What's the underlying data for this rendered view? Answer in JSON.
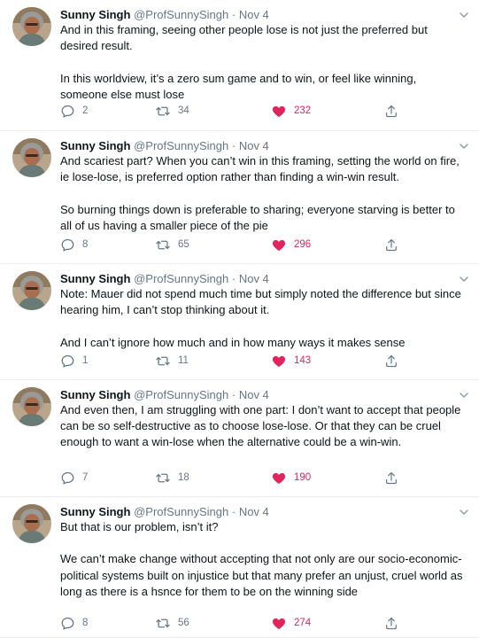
{
  "author": {
    "name": "Sunny Singh",
    "handle": "@ProfSunnySingh",
    "separator": "·"
  },
  "icons": {
    "reply": "reply-icon",
    "retweet": "retweet-icon",
    "like": "heart-icon",
    "share": "share-icon",
    "menu": "chevron-down-icon"
  },
  "colors": {
    "like": "#e0245e",
    "muted": "#657786",
    "text": "#0f1419"
  },
  "tweets": [
    {
      "date": "Nov 4",
      "paragraphs": [
        "And in this framing, seeing other people lose is not just the preferred but desired result.",
        "In this worldview, it’s a zero sum game and to win, or feel like winning, someone else must lose"
      ],
      "replies": "2",
      "retweets": "34",
      "likes": "232"
    },
    {
      "date": "Nov 4",
      "paragraphs": [
        "And scariest part? When you can’t win in this framing, setting the world on fire, ie lose-lose, is preferred option rather than finding a win-win result.",
        "So burning things down is preferable to sharing; everyone starving is better to all of us having a smaller piece of the pie"
      ],
      "replies": "8",
      "retweets": "65",
      "likes": "296"
    },
    {
      "date": "Nov 4",
      "paragraphs": [
        "Note: Mauer did not spend much time but simply noted the difference but since hearing him, I can’t stop thinking about it.",
        "And I can’t ignore how much and in how many ways it makes sense"
      ],
      "replies": "1",
      "retweets": "11",
      "likes": "143"
    },
    {
      "date": "Nov 4",
      "paragraphs": [
        "And even then, I am struggling with one part: I don’t want to accept that people can be so self-destructive as to choose lose-lose. Or that they can be cruel enough to want a win-lose when the alternative could be a win-win."
      ],
      "replies": "7",
      "retweets": "18",
      "likes": "190"
    },
    {
      "date": "Nov 4",
      "paragraphs": [
        "But that is our problem, isn’t it?",
        "We can’t make change without accepting that not only are our socio-economic-political systems built on injustice but that many prefer an unjust, cruel world as long as there is a hsnce for them to be on the winning side"
      ],
      "replies": "8",
      "retweets": "56",
      "likes": "274"
    }
  ]
}
